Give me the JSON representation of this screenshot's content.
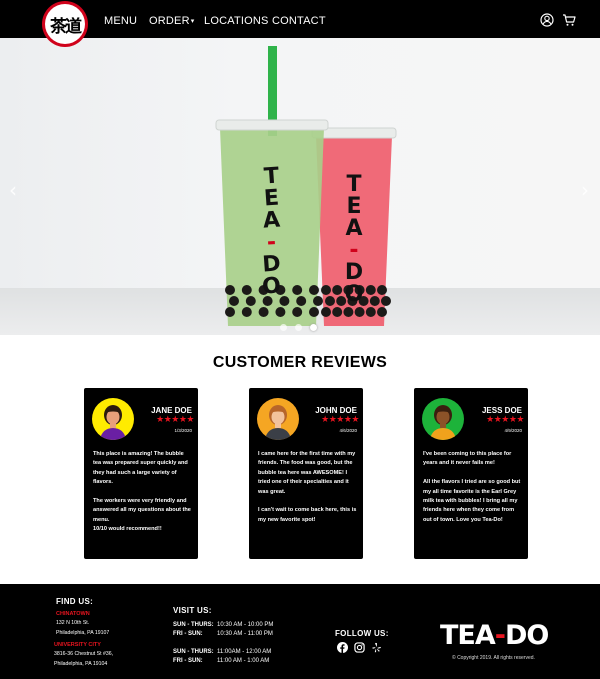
{
  "nav": {
    "logo_text": "茶道",
    "items": [
      {
        "label": "MENU"
      },
      {
        "label": "ORDER"
      },
      {
        "label": "LOCATIONS"
      },
      {
        "label": "CONTACT"
      }
    ],
    "order_caret": "▾"
  },
  "hero": {
    "cups": [
      {
        "brand": "TEA-DO",
        "drink_color": "#a8cf8a"
      },
      {
        "brand": "TEA-DO",
        "drink_color": "#ef5d6c"
      }
    ],
    "straw_color": "#2fb34a",
    "prev_arrow": "‹",
    "next_arrow": "›",
    "active_slide": 3,
    "slide_count": 3
  },
  "reviews": {
    "title": "CUSTOMER REVIEWS",
    "items": [
      {
        "name": "JANE DOE",
        "stars": "★★★★★",
        "date": "1/3/2020",
        "avatar_bg": "#ffeb00",
        "text": "This place is amazing! The bubble tea was prepared super quickly and they had such a large variety of flavors.\n\nThe workers were very friendly and answered all my questions about the menu.\n10/10 would recommend!!"
      },
      {
        "name": "JOHN DOE",
        "stars": "★★★★★",
        "date": "4/6/2020",
        "avatar_bg": "#f5a623",
        "text": "I came here for the first time with my friends. The food was good, but the bubble tea here was AWESOME! I tried one of their specialties and it was great.\n\nI can't wait to come back here, this is my new favorite spot!"
      },
      {
        "name": "JESS DOE",
        "stars": "★★★★★",
        "date": "4/9/2020",
        "avatar_bg": "#1db33a",
        "text": "I've been coming to this place for years and it never fails me!\n\nAll the flavors I tried are so good but my all time favorite is the Earl Grey milk tea with bubbles! I bring all my friends here when they come from out of town. Love you Tea-Do!"
      }
    ]
  },
  "footer": {
    "find_us": "FIND US:",
    "locations": [
      {
        "name": "CHINATOWN",
        "address": "132 N 10th St.\nPhiladelphia, PA 19107"
      },
      {
        "name": "UNIVERSITY CITY",
        "address": "3816-36 Chestnut St #36,\nPhiladelphia, PA 19104"
      }
    ],
    "visit_us": "VISIT US:",
    "hours": [
      {
        "days": "SUN - THURS:",
        "time": "10:30 AM - 10:00 PM"
      },
      {
        "days": "FRI - SUN:",
        "time": "10:30 AM - 11:00 PM"
      },
      {
        "days": "SUN - THURS:",
        "time": "11:00AM - 12:00 AM"
      },
      {
        "days": "FRI - SUN:",
        "time": "11:00 AM - 1:00 AM"
      }
    ],
    "follow_us": "FOLLOW US:",
    "brand": {
      "part1": "TEA",
      "dash": "-",
      "part2": "DO"
    },
    "copyright": "© Copyright 2019. All rights reserved."
  },
  "colors": {
    "accent": "#e8141f",
    "nav_bg": "#000000",
    "logo_red": "#d0021b"
  }
}
